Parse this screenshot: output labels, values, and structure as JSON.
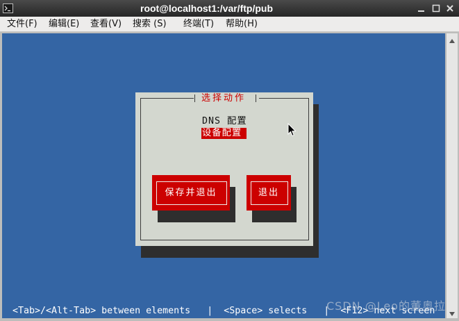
{
  "window": {
    "title": "root@localhost1:/var/ftp/pub"
  },
  "menu": [
    {
      "label": "文件(F)"
    },
    {
      "label": "编辑(E)"
    },
    {
      "label": "查看(V)"
    },
    {
      "label": "搜索 (S)"
    },
    {
      "label": "终端(T)"
    },
    {
      "label": "帮助(H)"
    }
  ],
  "dialog": {
    "title": "选择动作",
    "items": [
      {
        "label": "DNS 配置",
        "selected": false
      },
      {
        "label": "设备配置",
        "selected": true
      }
    ],
    "buttons": [
      {
        "label": "保存并退出"
      },
      {
        "label": "退出"
      }
    ]
  },
  "status_line": "<Tab>/<Alt-Tab> between elements   |  <Space> selects   |  <F12> next screen",
  "watermark": "CSDN @Leo的董奥拉",
  "icons": {
    "app": "terminal-icon",
    "minimize": "minimize-icon",
    "maximize": "maximize-icon",
    "close": "close-icon",
    "scroll_up": "scroll-up-icon",
    "scroll_down": "scroll-down-icon",
    "pointer": "mouse-cursor-icon"
  },
  "colors": {
    "terminal_bg": "#3465a4",
    "dialog_bg": "#d3d7cf",
    "accent_red": "#cc0000",
    "shadow": "#2e2e2e",
    "text_light": "#ffffff"
  }
}
